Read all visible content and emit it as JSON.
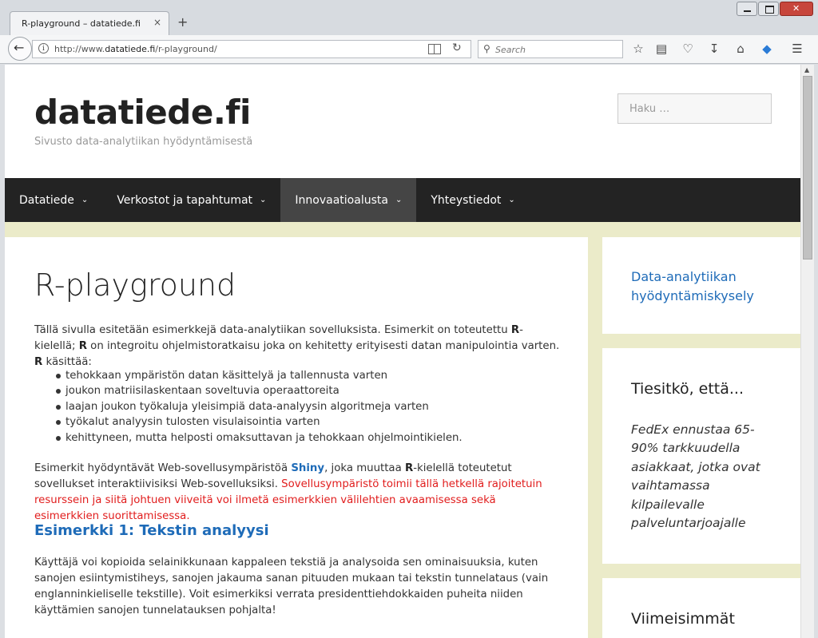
{
  "browser": {
    "tab_title": "R-playground – datatiede.fi",
    "tab_close": "×",
    "new_tab": "+",
    "url_prefix": "http://www.",
    "url_domain": "datatiede.fi",
    "url_path": "/r-playground/",
    "search_placeholder": "Search"
  },
  "site": {
    "title": "datatiede.fi",
    "description": "Sivusto data-analytiikan hyödyntämisestä",
    "search_placeholder": "Haku …"
  },
  "nav": [
    {
      "label": "Datatiede"
    },
    {
      "label": "Verkostot ja tapahtumat"
    },
    {
      "label": "Innovaatioalusta",
      "active": true
    },
    {
      "label": "Yhteystiedot"
    }
  ],
  "main": {
    "title": "R-playground",
    "intro_1": "Tällä sivulla esitetään esimerkkejä data-analytiikan sovelluksista. Esimerkit on toteutettu ",
    "intro_r1": "R",
    "intro_2": "-kielellä; ",
    "intro_r2": "R",
    "intro_3": " on integroitu ohjelmistoratkaisu joka on kehitetty erityisesti datan manipulointia varten. ",
    "intro_r3": "R",
    "intro_4": " käsittää:",
    "bullets": [
      "tehokkaan ympäristön datan käsittelyä ja tallennusta varten",
      "joukon matriisilaskentaan soveltuvia operaattoreita",
      "laajan joukon työkaluja yleisimpiä data-analyysin algoritmeja varten",
      "työkalut analyysin tulosten visulaisointia varten",
      "kehittyneen, mutta helposti omaksuttavan ja tehokkaan ohjelmointikielen."
    ],
    "shiny_1": "Esimerkit hyödyntävät Web-sovellusympäristöä ",
    "shiny_link": "Shiny",
    "shiny_2": ", joka muuttaa ",
    "shiny_r": "R",
    "shiny_3": "-kielellä toteutetut sovellukset interaktiivisiksi Web-sovelluksiksi. ",
    "shiny_red": "Sovellusympäristö toimii tällä hetkellä rajoitetuin resurssein ja siitä johtuen viiveitä voi ilmetä esimerkkien välilehtien avaamisessa sekä esimerkkien suorittamisessa.",
    "example1_heading": "Esimerkki 1: Tekstin analyysi",
    "example1_text": "Käyttäjä voi kopioida selainikkunaan kappaleen tekstiä ja analysoida sen ominaisuuksia, kuten sanojen esiintymistiheys, sanojen jakauma sanan pituuden mukaan tai tekstin tunnelataus (vain englanninkieliselle tekstille). Voit esimerkiksi verrata presidenttiehdokkaiden puheita niiden käyttämien sanojen tunnelatauksen pohjalta!"
  },
  "sidebar": {
    "survey_link": "Data-analytiikan hyödyntämiskysely",
    "did_you_know_heading": "Tiesitkö, että...",
    "did_you_know_text": "FedEx ennustaa 65-90% tarkkuudella asiakkaat, jotka ovat vaihtamassa kilpailevalle palveluntarjoajalle",
    "recent_heading": "Viimeisimmät"
  }
}
